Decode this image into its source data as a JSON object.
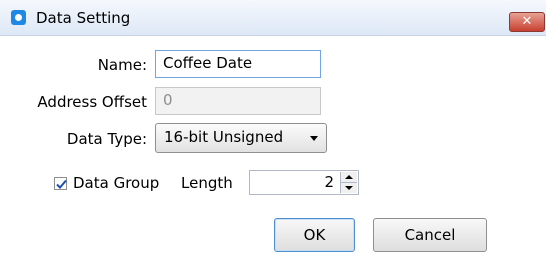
{
  "window": {
    "title": "Data Setting",
    "close_symbol": "✕"
  },
  "form": {
    "name_label": "Name:",
    "name_value": "Coffee Date",
    "address_label": "Address Offset",
    "address_value": "0",
    "type_label": "Data Type:",
    "type_value": "16-bit Unsigned",
    "group_label": "Data Group",
    "group_checked": true,
    "length_label": "Length",
    "length_value": "2"
  },
  "buttons": {
    "ok": "OK",
    "cancel": "Cancel"
  }
}
